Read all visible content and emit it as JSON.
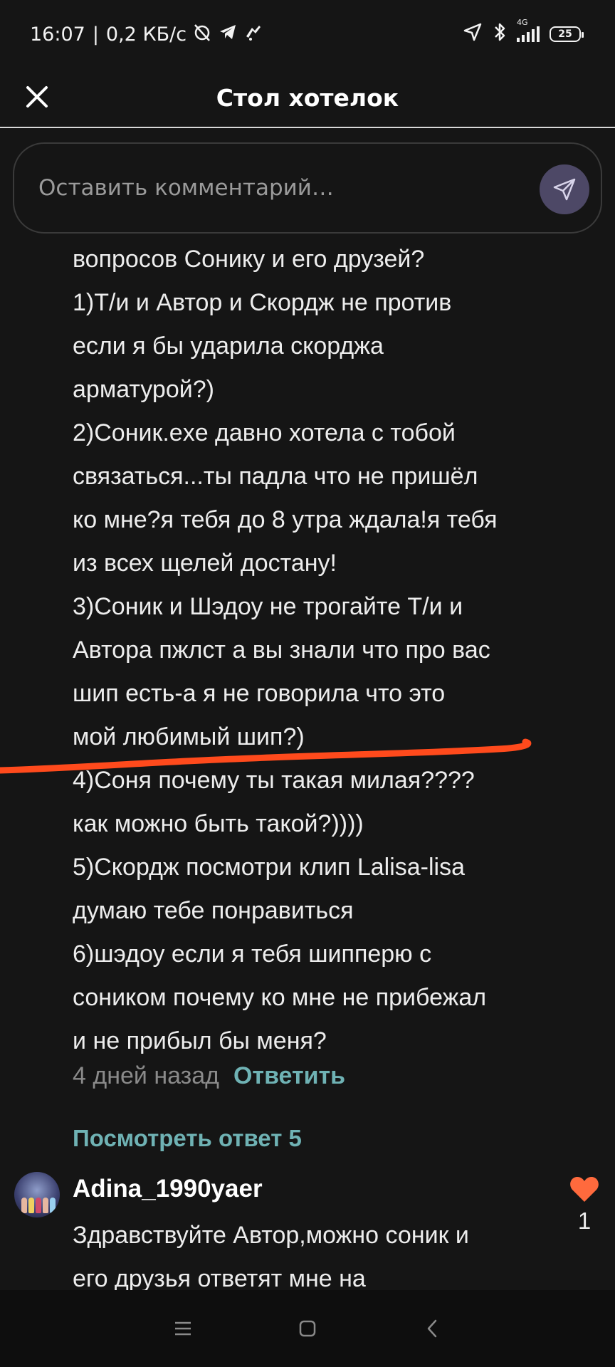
{
  "status_bar": {
    "time": "16:07",
    "network_speed": "0,2 КБ/с",
    "network_type": "4G",
    "battery": "25"
  },
  "header": {
    "title": "Стол хотелок"
  },
  "comment_input": {
    "placeholder": "Оставить комментарий…"
  },
  "comment": {
    "lines": [
      "вопросов Сонику и его друзей?",
      "1)Т/и и Автор и Скордж не против",
      "если я бы ударила скорджа",
      "арматурой?)",
      "2)Соник.exe давно хотела с тобой",
      "связаться...ты падла что не пришёл",
      "ко мне?я тебя до 8 утра ждала!я тебя",
      "из всех щелей достану!",
      "3)Соник и Шэдоу не трогайте Т/и и",
      "Автора пжлст а вы знали что про вас",
      "шип есть-а я не говорила что это",
      "мой любимый шип?)",
      "4)Соня почему ты такая милая????",
      "как можно быть такой?))))",
      "5)Скордж посмотри клип Lalisa-lisa",
      "думаю тебе понравиться",
      "6)шэдоу если я тебя шипперю с",
      "соником почему ко мне не прибежал",
      "и не прибыл бы меня?"
    ],
    "time": "4 дней назад",
    "reply_label": "Ответить",
    "view_replies_label": "Посмотреть ответ 5"
  },
  "next_comment": {
    "username": "Adina_1990yaer",
    "lines": [
      "Здравствуйте Автор,можно соник и",
      "его друзья ответят мне на"
    ],
    "likes": "1"
  },
  "colors": {
    "accent": "#6fb2b4",
    "like": "#ff6a3d",
    "scribble": "#ff4a1c",
    "send_button": "#4d4866"
  },
  "icons": {
    "close": "close-icon",
    "send": "send-icon",
    "like": "heart-icon",
    "nav_menu": "menu-icon",
    "nav_home": "home-icon",
    "nav_back": "back-icon"
  }
}
